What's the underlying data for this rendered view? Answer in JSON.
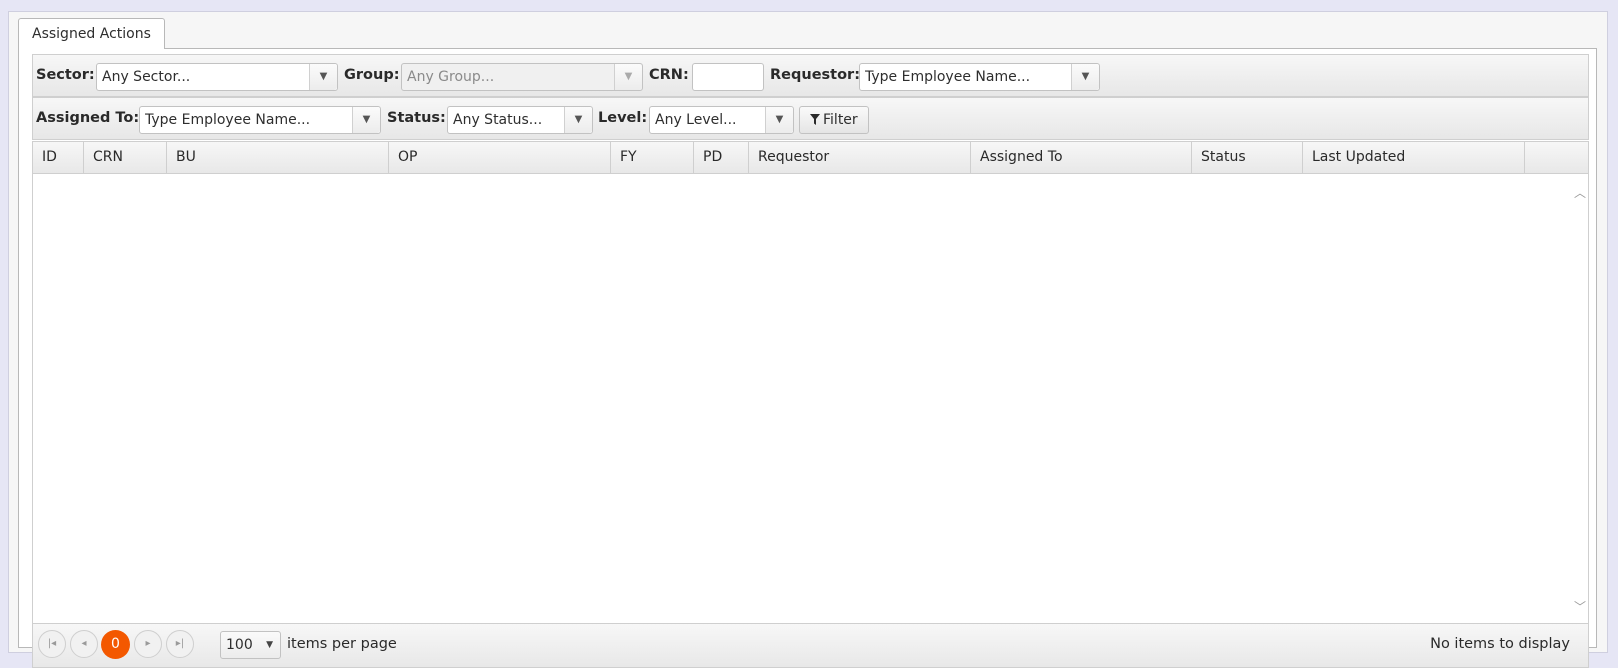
{
  "tab": {
    "label": "Assigned Actions"
  },
  "filters": {
    "sector": {
      "label": "Sector:",
      "value": "Any Sector..."
    },
    "group": {
      "label": "Group:",
      "value": "Any Group..."
    },
    "crn": {
      "label": "CRN:",
      "value": ""
    },
    "requestor": {
      "label": "Requestor:",
      "value": "Type Employee Name..."
    },
    "assigned_to": {
      "label": "Assigned To:",
      "value": "Type Employee Name..."
    },
    "status": {
      "label": "Status:",
      "value": "Any Status..."
    },
    "level": {
      "label": "Level:",
      "value": "Any Level..."
    },
    "filter_button": "Filter"
  },
  "grid": {
    "columns": [
      "ID",
      "CRN",
      "BU",
      "OP",
      "FY",
      "PD",
      "Requestor",
      "Assigned To",
      "Status",
      "Last Updated"
    ],
    "rows": []
  },
  "pager": {
    "current_page": "0",
    "page_size": "100",
    "items_per_page_label": "items per page",
    "info": "No items to display"
  },
  "colors": {
    "accent": "#f35800",
    "page_background": "#e6e6f5"
  },
  "icons": {
    "combo_arrow": "chevron-down-icon",
    "filter": "funnel-icon",
    "first": "first-page-icon",
    "prev": "previous-page-icon",
    "next": "next-page-icon",
    "last": "last-page-icon"
  }
}
